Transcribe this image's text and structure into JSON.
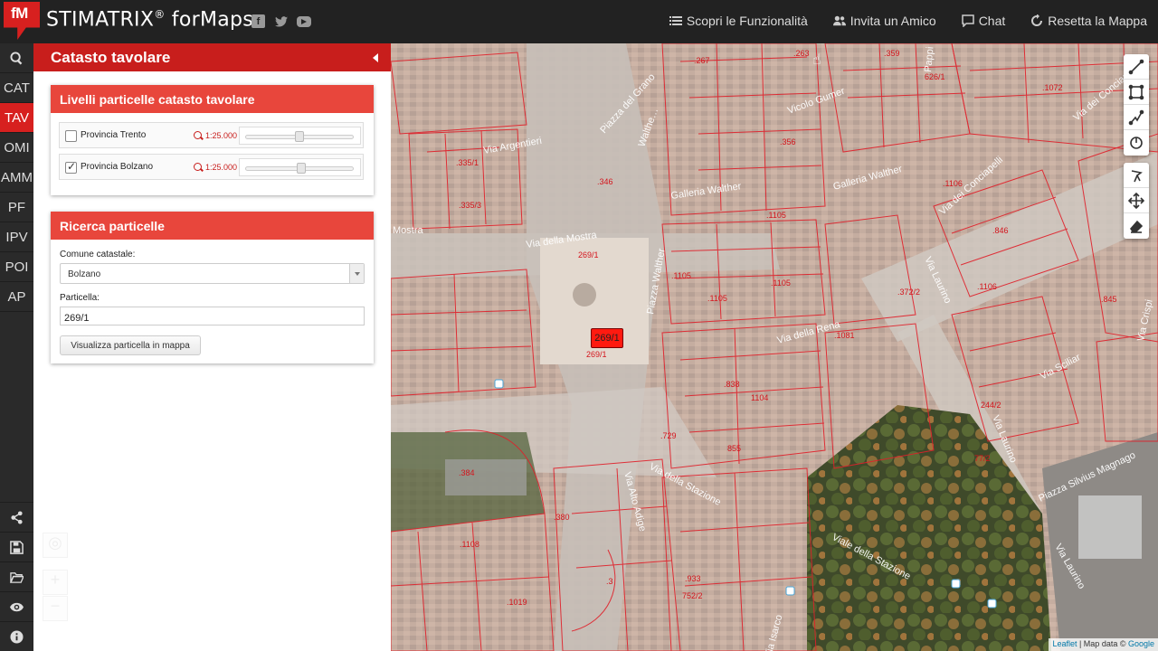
{
  "app": {
    "logo_text": "fM",
    "brand_name": "STIMATRIX",
    "brand_reg": "®",
    "brand_suffix": " forMaps"
  },
  "social_icons": [
    "facebook-icon",
    "twitter-icon",
    "youtube-icon"
  ],
  "top_nav": [
    {
      "label": "Scopri le Funzionalità",
      "icon": "list-icon"
    },
    {
      "label": "Invita un Amico",
      "icon": "users-icon"
    },
    {
      "label": "Chat",
      "icon": "chat-icon"
    },
    {
      "label": "Resetta la Mappa",
      "icon": "refresh-icon"
    }
  ],
  "side_nav": {
    "search_icon": "search-icon",
    "items": [
      "CAT",
      "TAV",
      "OMI",
      "AMM",
      "PF",
      "IPV",
      "POI",
      "AP"
    ],
    "active": "TAV",
    "bottom_icons": [
      "share-icon",
      "save-icon",
      "folder-open-icon",
      "eye-icon",
      "info-icon"
    ]
  },
  "panel": {
    "title": "Catasto tavolare",
    "layers_card": {
      "title": "Livelli particelle catasto tavolare",
      "layers": [
        {
          "name": "Provincia Trento",
          "checked": false,
          "scale": "1:25.000",
          "opacity": 0.5
        },
        {
          "name": "Provincia Bolzano",
          "checked": true,
          "scale": "1:25.000",
          "opacity": 0.52
        }
      ]
    },
    "search_card": {
      "title": "Ricerca particelle",
      "comune_label": "Comune catastale:",
      "comune_value": "Bolzano",
      "particella_label": "Particella:",
      "particella_value": "269/1",
      "button_label": "Visualizza particella in mappa"
    }
  },
  "map": {
    "highlight_label": "269/1",
    "attribution_link": "Leaflet",
    "attribution_text": " | Map data © ",
    "attribution_provider": "Google",
    "street_names": [
      "Piazza del Grano",
      "Vicolo Gumer",
      "Via Argentieri",
      "Galleria Walther",
      "Galleria Walther",
      "Via dei Conciapelli",
      "Via della Mostra",
      "Piazza Walther",
      "Via Laurino",
      "Via della Rena",
      "Via Sciliar",
      "Via della Stazione",
      "Via Alto Adige",
      "Viale della Stazione",
      "Piazza Silvius Magnago",
      "Via Laurino",
      "Via Laurino",
      "Via dei Conciapelli",
      "Via Crispi",
      "Via Isarco",
      "Walthe…",
      "Mostra",
      "Pappi"
    ],
    "parcel_numbers": [
      ".267",
      ".263",
      ".359",
      ".1072",
      ".356",
      ".1105",
      ".846",
      ".1106",
      ".1105",
      ".845",
      ".1105",
      ".1105",
      ".1106",
      "269/1",
      ".1081",
      ".384",
      ".380",
      ".1108",
      ".1019",
      ".933",
      "752/2",
      ".3",
      "269/1",
      ".372/2",
      "244/2",
      "77/2",
      "626/1",
      ".838",
      ".729",
      "855",
      ".335/1",
      ".335/3",
      ".346",
      "1104"
    ],
    "tools": [
      "polyline-icon",
      "rectangle-icon",
      "polygon-icon",
      "circle-icon",
      "pointer-edit-icon",
      "move-icon",
      "eraser-icon"
    ]
  },
  "colors": {
    "brand_red": "#d7201f",
    "panel_header": "#c81e1c",
    "card_header": "#e8463c",
    "topbar": "#222222",
    "parcel_line": "#e0202a"
  }
}
